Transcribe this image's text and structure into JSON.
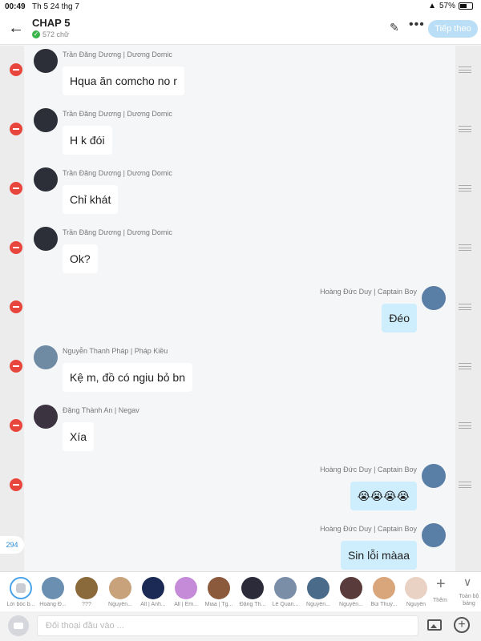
{
  "status_bar": {
    "time": "00:49",
    "date": "Th 5 24 thg 7",
    "battery": "57%"
  },
  "header": {
    "title": "CHAP 5",
    "word_count": "572 chữ",
    "next_button": "Tiếp theo"
  },
  "messages": [
    {
      "sender": "Trần Đăng Dương | Dương Domic",
      "text": "Hqua ăn comcho no r",
      "side": "left"
    },
    {
      "sender": "Trần Đăng Dương | Dương Domic",
      "text": "H k đói",
      "side": "left"
    },
    {
      "sender": "Trần Đăng Dương | Dương Domic",
      "text": "Chỉ khát",
      "side": "left"
    },
    {
      "sender": "Trần Đăng Dương | Dương Domic",
      "text": "Ok?",
      "side": "left"
    },
    {
      "sender": "Hoàng Đức Duy | Captain Boy",
      "text": "Đéo",
      "side": "right"
    },
    {
      "sender": "Nguyễn Thanh Pháp | Pháp Kiều",
      "text": "Kệ m, đồ có ngiu bỏ bn",
      "side": "left"
    },
    {
      "sender": "Đặng Thành An | Negav",
      "text": "Xía",
      "side": "left"
    },
    {
      "sender": "Hoàng Đức Duy | Captain Boy",
      "text": "😭😭😭😭",
      "side": "right"
    },
    {
      "sender": "Hoàng Đức Duy | Captain Boy",
      "text": "Sin lỗi màaa",
      "side": "right"
    }
  ],
  "side_badge": "294",
  "characters": [
    {
      "name": "Lời bốc b...",
      "color": "#ffffff"
    },
    {
      "name": "Hoàng Đ...",
      "color": "#6a8fb0"
    },
    {
      "name": "???",
      "color": "#8a6a3a"
    },
    {
      "name": "Nguyễn...",
      "color": "#c7a27a"
    },
    {
      "name": "All | Anh...",
      "color": "#1b2a55"
    },
    {
      "name": "All | Em...",
      "color": "#c58bd8"
    },
    {
      "name": "Miaa | Tg...",
      "color": "#8b5a3c"
    },
    {
      "name": "Đặng Th...",
      "color": "#2b2b3a"
    },
    {
      "name": "Lê Quan...",
      "color": "#7a8ea8"
    },
    {
      "name": "Nguyễn...",
      "color": "#4a6b8a"
    },
    {
      "name": "Nguyễn...",
      "color": "#5a3b3b"
    },
    {
      "name": "Bùi Thuỳ...",
      "color": "#d9a57a"
    },
    {
      "name": "Nguyễn",
      "color": "#e9d2c4"
    }
  ],
  "add_label": "Thêm",
  "expand_label": "Toàn bộ bảng",
  "input": {
    "placeholder": "Đối thoại đầu vào ..."
  }
}
